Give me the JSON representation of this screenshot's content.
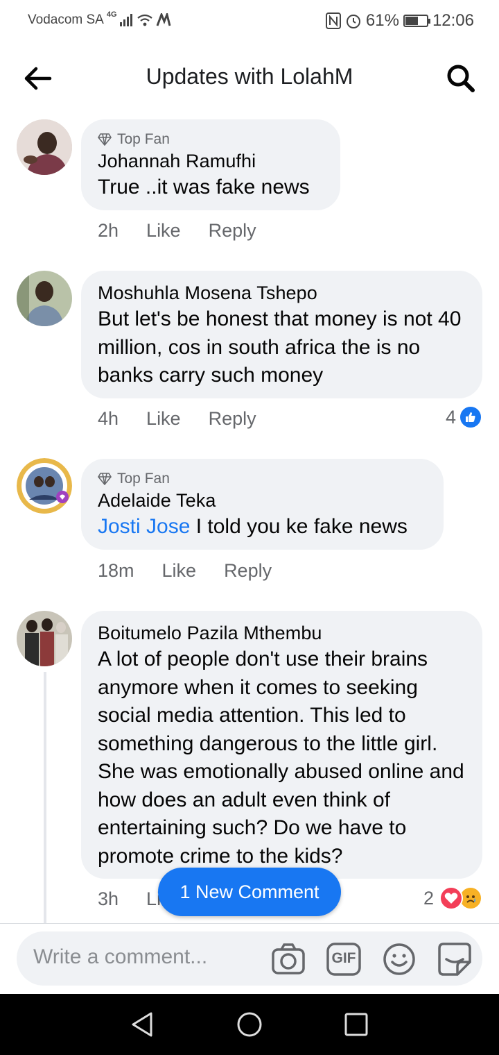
{
  "status_bar": {
    "carrier": "Vodacom SA",
    "network": "4G",
    "battery": "61%",
    "battery_level": 0.61,
    "time": "12:06"
  },
  "header": {
    "title": "Updates with LolahM",
    "back_icon": "arrow-left-icon",
    "search_icon": "search-icon"
  },
  "comments": [
    {
      "badge": "Top Fan",
      "author": "Johannah Ramufhi",
      "text": "True ..it was fake news",
      "time": "2h",
      "like": "Like",
      "reply": "Reply"
    },
    {
      "author": "Moshuhla Mosena Tshepo",
      "text": "But let's be honest that money is not 40 million, cos in south africa the is no banks carry such money",
      "time": "4h",
      "like": "Like",
      "reply": "Reply",
      "reaction_count": "4"
    },
    {
      "badge": "Top Fan",
      "author": "Adelaide Teka",
      "mention": "Josti Jose",
      "text": " I told you ke fake news",
      "time": "18m",
      "like": "Like",
      "reply": "Reply"
    },
    {
      "author": "Boitumelo Pazila Mthembu",
      "text": "A lot of people don't use their brains anymore when it comes to seeking social media attention. This led to something dangerous to the little girl. She was emotionally abused online and how does an adult even think of entertaining  such? Do we have to promote crime to the kids?",
      "time": "3h",
      "like": "Li",
      "reaction_count": "2"
    }
  ],
  "new_comment_pill": "1 New Comment",
  "composer": {
    "placeholder": "Write a comment...",
    "gif_label": "GIF"
  },
  "colors": {
    "accent": "#1877f2",
    "bubble": "#f0f2f5",
    "secondary_text": "#65676b"
  }
}
